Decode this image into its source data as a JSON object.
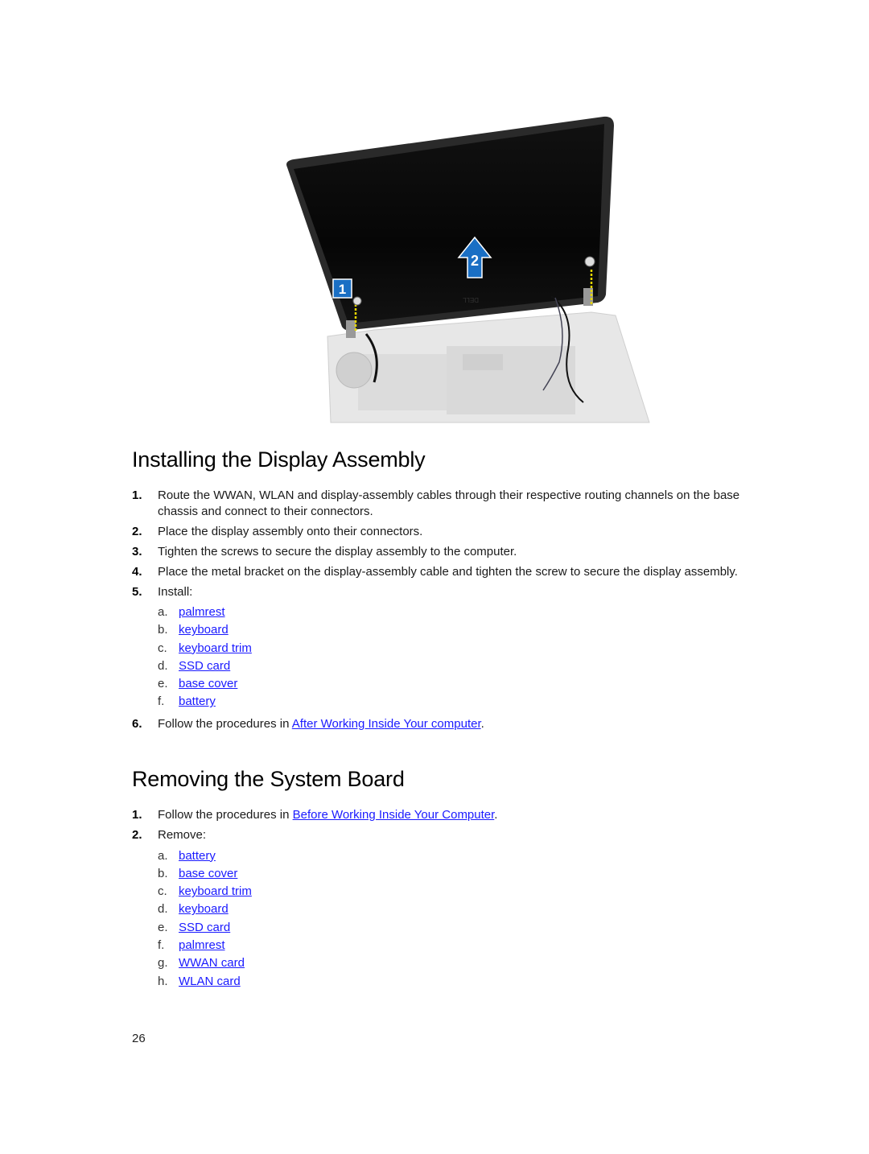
{
  "figure": {
    "description": "Laptop display assembly being lifted from base chassis",
    "callouts": [
      {
        "label": "1",
        "type": "box",
        "meaning": "screws"
      },
      {
        "label": "2",
        "type": "arrow-up",
        "meaning": "lift display"
      }
    ],
    "callout_color": "#1a6fc4",
    "logo_text": "DELL"
  },
  "section1": {
    "title": "Installing the Display Assembly",
    "steps": [
      {
        "num": "1.",
        "text": "Route the WWAN, WLAN and display-assembly cables through their respective routing channels on the base chassis and connect to their connectors."
      },
      {
        "num": "2.",
        "text": "Place the display assembly onto their connectors."
      },
      {
        "num": "3.",
        "text": "Tighten the screws to secure the display assembly to the computer."
      },
      {
        "num": "4.",
        "text": "Place the metal bracket on the display-assembly cable and tighten the screw to secure the display assembly."
      },
      {
        "num": "5.",
        "text": "Install:",
        "sub": [
          {
            "letter": "a.",
            "link": "palmrest"
          },
          {
            "letter": "b.",
            "link": "keyboard"
          },
          {
            "letter": "c.",
            "link": "keyboard trim"
          },
          {
            "letter": "d.",
            "link": "SSD card"
          },
          {
            "letter": "e.",
            "link": "base cover"
          },
          {
            "letter": "f.",
            "link": "battery"
          }
        ]
      },
      {
        "num": "6.",
        "prefix": "Follow the procedures in ",
        "link": "After Working Inside Your computer",
        "suffix": "."
      }
    ]
  },
  "section2": {
    "title": "Removing the System Board",
    "steps": [
      {
        "num": "1.",
        "prefix": "Follow the procedures in ",
        "link": "Before Working Inside Your Computer",
        "suffix": "."
      },
      {
        "num": "2.",
        "text": "Remove:",
        "sub": [
          {
            "letter": "a.",
            "link": "battery"
          },
          {
            "letter": "b.",
            "link": "base cover"
          },
          {
            "letter": "c.",
            "link": "keyboard trim"
          },
          {
            "letter": "d.",
            "link": "keyboard"
          },
          {
            "letter": "e.",
            "link": "SSD card"
          },
          {
            "letter": "f.",
            "link": "palmrest"
          },
          {
            "letter": "g.",
            "link": "WWAN card"
          },
          {
            "letter": "h.",
            "link": "WLAN card"
          }
        ]
      }
    ]
  },
  "footer": {
    "page_number": "26"
  },
  "colors": {
    "link": "#1a1aff",
    "text": "#1a1a1a",
    "heading": "#000000"
  }
}
